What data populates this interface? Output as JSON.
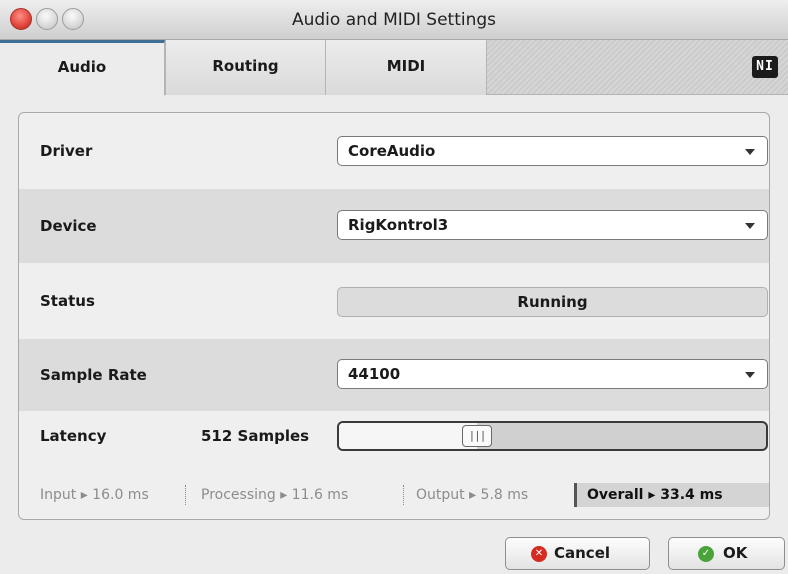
{
  "window": {
    "title": "Audio and MIDI Settings"
  },
  "tabs": [
    {
      "label": "Audio",
      "active": true
    },
    {
      "label": "Routing",
      "active": false
    },
    {
      "label": "MIDI",
      "active": false
    }
  ],
  "brand": {
    "logo_text": "NI"
  },
  "settings": {
    "driver": {
      "label": "Driver",
      "value": "CoreAudio"
    },
    "device": {
      "label": "Device",
      "value": "RigKontrol3"
    },
    "status": {
      "label": "Status",
      "value": "Running"
    },
    "sample_rate": {
      "label": "Sample Rate",
      "value": "44100"
    },
    "latency": {
      "label": "Latency",
      "value": "512 Samples",
      "slider_level": 0.31,
      "thumb_grip": "|||"
    }
  },
  "timings": {
    "input": "Input ▸ 16.0 ms",
    "processing": "Processing ▸ 11.6 ms",
    "output": "Output ▸ 5.8 ms",
    "overall": "Overall ▸ 33.4 ms"
  },
  "buttons": {
    "cancel": {
      "label": "Cancel",
      "icon": "x-circle-icon"
    },
    "ok": {
      "label": "OK",
      "icon": "check-circle-icon"
    }
  },
  "colors": {
    "active_tab_accent": "#3f6f95",
    "cancel_icon": "#d52b22",
    "ok_icon": "#4aa33a"
  }
}
